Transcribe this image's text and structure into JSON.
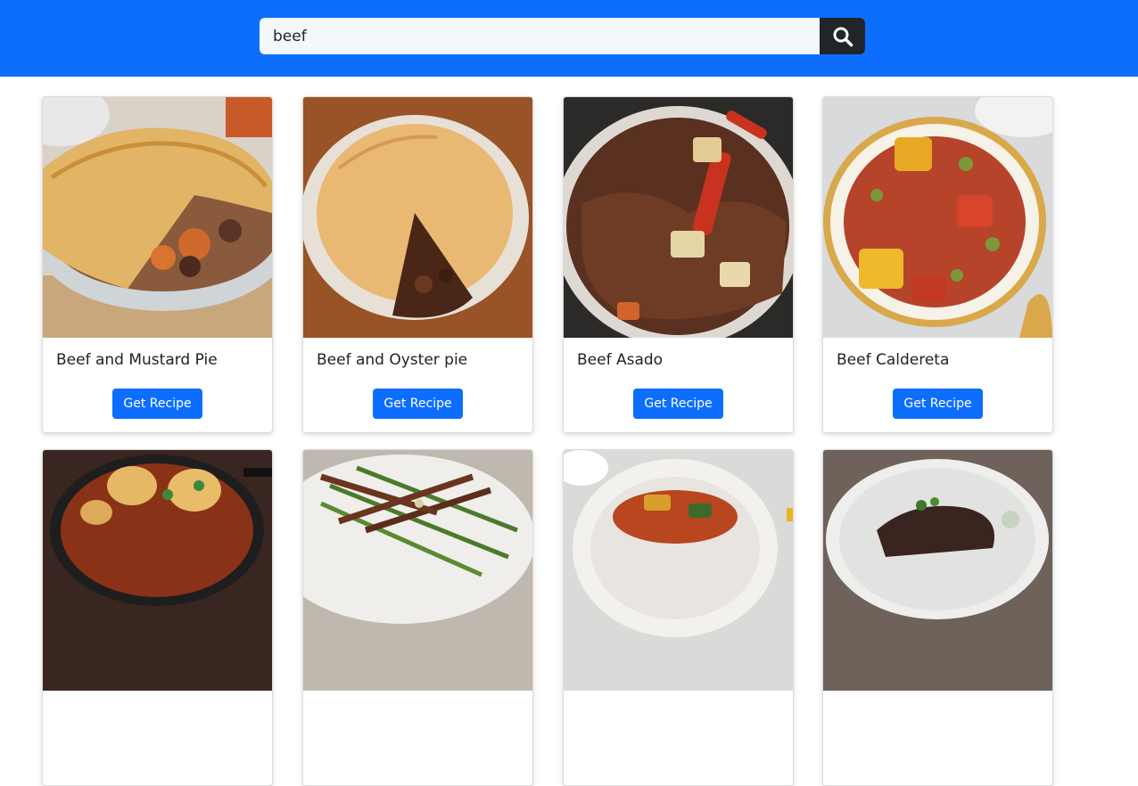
{
  "search": {
    "value": "beef",
    "button_icon": "search-icon"
  },
  "colors": {
    "header": "#0d6efd",
    "button": "#0d6efd",
    "search_button": "#212529"
  },
  "recipes": [
    {
      "title": "Beef and Mustard Pie",
      "button_label": "Get Recipe",
      "image": "beef-mustard-pie-photo"
    },
    {
      "title": "Beef and Oyster pie",
      "button_label": "Get Recipe",
      "image": "beef-oyster-pie-photo"
    },
    {
      "title": "Beef Asado",
      "button_label": "Get Recipe",
      "image": "beef-asado-photo"
    },
    {
      "title": "Beef Caldereta",
      "button_label": "Get Recipe",
      "image": "beef-caldereta-photo"
    },
    {
      "title": "",
      "button_label": "",
      "image": "beef-stew-dumplings-photo"
    },
    {
      "title": "",
      "button_label": "",
      "image": "beef-green-beans-photo"
    },
    {
      "title": "",
      "button_label": "",
      "image": "beef-stew-bowl-photo"
    },
    {
      "title": "",
      "button_label": "",
      "image": "beef-plate-photo"
    }
  ]
}
